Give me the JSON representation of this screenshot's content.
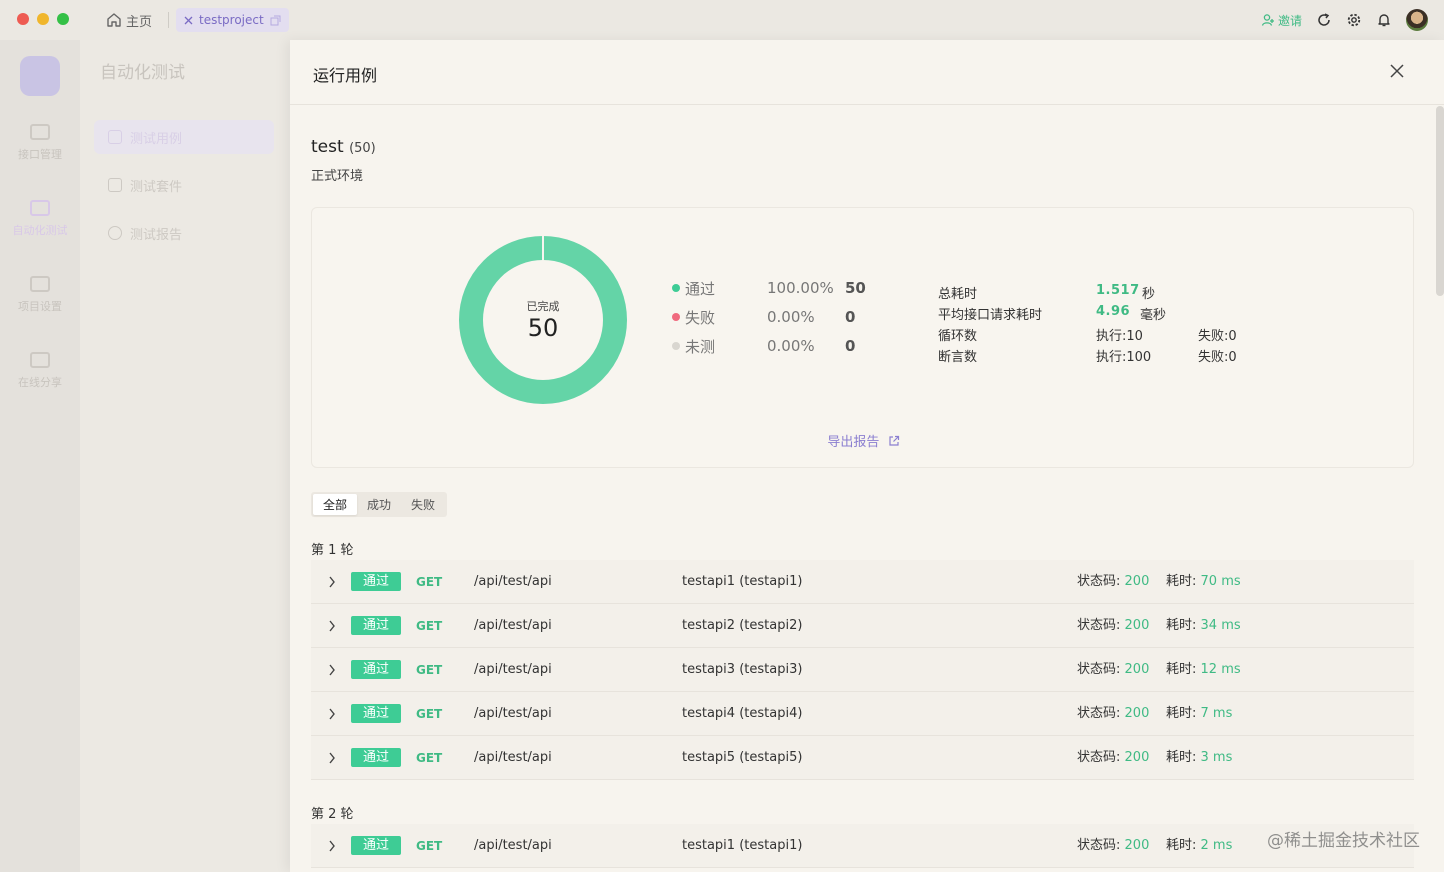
{
  "window": {
    "home_tab": "主页",
    "project_tab": "testproject",
    "invite": "邀请"
  },
  "nav": {
    "items": [
      {
        "label": "接口管理",
        "icon": "api-icon"
      },
      {
        "label": "自动化测试",
        "icon": "automation-icon"
      },
      {
        "label": "项目设置",
        "icon": "settings-icon"
      },
      {
        "label": "在线分享",
        "icon": "share-icon"
      }
    ]
  },
  "subnav": {
    "title": "自动化测试",
    "items": [
      {
        "label": "测试用例"
      },
      {
        "label": "测试套件"
      },
      {
        "label": "测试报告"
      }
    ]
  },
  "drawer": {
    "title": "运行用例",
    "project_name": "test",
    "project_count": "(50)",
    "environment": "正式环境",
    "export": "导出报告"
  },
  "summary": {
    "donut_label": "已完成",
    "donut_value": "50",
    "legend": [
      {
        "name": "通过",
        "pct": "100.00%",
        "count": "50",
        "color": "#3ecc95"
      },
      {
        "name": "失败",
        "pct": "0.00%",
        "count": "0",
        "color": "#f06a7e"
      },
      {
        "name": "未测",
        "pct": "0.00%",
        "count": "0",
        "color": "#d9d6d0"
      }
    ],
    "stats": {
      "total_time_label": "总耗时",
      "total_time_value": "1.517",
      "total_time_unit": "秒",
      "avg_label": "平均接口请求耗时",
      "avg_value": "4.96",
      "avg_unit": "毫秒",
      "loop_label": "循环数",
      "loop_exec": "执行:10",
      "loop_fail": "失败:0",
      "assert_label": "断言数",
      "assert_exec": "执行:100",
      "assert_fail": "失败:0"
    }
  },
  "filter_tabs": [
    "全部",
    "成功",
    "失败"
  ],
  "rounds": [
    {
      "title": "第 1 轮",
      "cases": [
        {
          "status": "通过",
          "method": "GET",
          "path": "/api/test/api",
          "name": "testapi1 (testapi1)",
          "code_label": "状态码:",
          "code": "200",
          "time_label": "耗时:",
          "time": "70 ms"
        },
        {
          "status": "通过",
          "method": "GET",
          "path": "/api/test/api",
          "name": "testapi2 (testapi2)",
          "code_label": "状态码:",
          "code": "200",
          "time_label": "耗时:",
          "time": "34 ms"
        },
        {
          "status": "通过",
          "method": "GET",
          "path": "/api/test/api",
          "name": "testapi3 (testapi3)",
          "code_label": "状态码:",
          "code": "200",
          "time_label": "耗时:",
          "time": "12 ms"
        },
        {
          "status": "通过",
          "method": "GET",
          "path": "/api/test/api",
          "name": "testapi4 (testapi4)",
          "code_label": "状态码:",
          "code": "200",
          "time_label": "耗时:",
          "time": "7 ms"
        },
        {
          "status": "通过",
          "method": "GET",
          "path": "/api/test/api",
          "name": "testapi5 (testapi5)",
          "code_label": "状态码:",
          "code": "200",
          "time_label": "耗时:",
          "time": "3 ms"
        }
      ]
    },
    {
      "title": "第 2 轮",
      "cases": [
        {
          "status": "通过",
          "method": "GET",
          "path": "/api/test/api",
          "name": "testapi1 (testapi1)",
          "code_label": "状态码:",
          "code": "200",
          "time_label": "耗时:",
          "time": "2 ms"
        }
      ]
    }
  ],
  "watermark": "@稀土掘金技术社区"
}
